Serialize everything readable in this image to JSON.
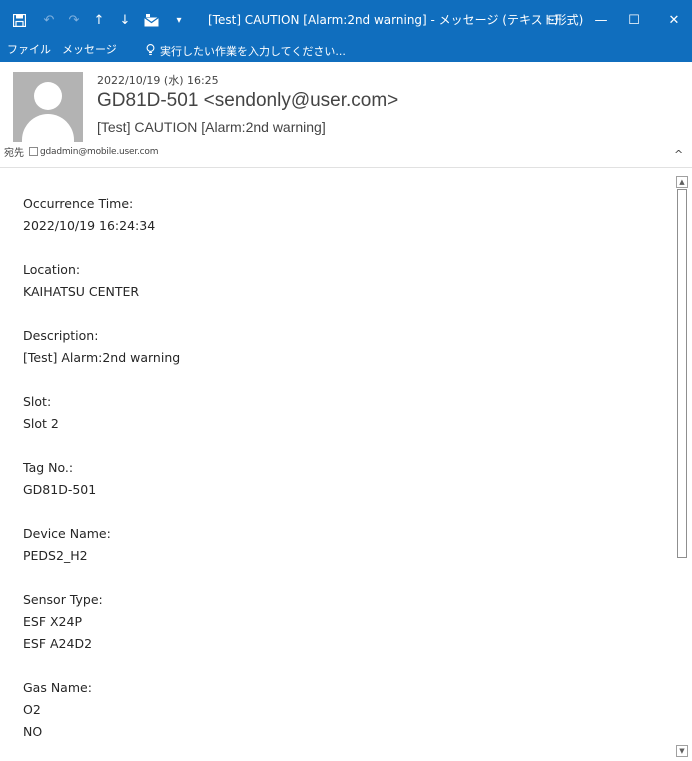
{
  "window": {
    "title": "[Test] CAUTION [Alarm:2nd warning] - メッセージ (テキスト形式)",
    "buttons": {
      "ribbon_display": "⊡",
      "minimize": "—",
      "maximize": "☐",
      "close": "✕"
    }
  },
  "qat": {
    "save_icon": "save-icon",
    "undo_icon": "undo-icon",
    "redo_icon": "redo-icon",
    "up_icon": "arrow-up-icon",
    "down_icon": "arrow-down-icon",
    "envelope_icon": "envelope-icon",
    "customize_icon": "customize-qat-icon"
  },
  "ribbon": {
    "tabs": [
      {
        "label": "ファイル"
      },
      {
        "label": "メッセージ"
      }
    ],
    "tell_me": "実行したい作業を入力してください..."
  },
  "header": {
    "date": "2022/10/19 (水) 16:25",
    "sender": "GD81D-501 <sendonly@user.com>",
    "subject": "[Test] CAUTION [Alarm:2nd warning]",
    "to_label": "宛先",
    "to_address": "gdadmin@mobile.user.com",
    "collapse_symbol": "^"
  },
  "body": {
    "occurrence_label": "Occurrence Time:",
    "occurrence_value": "2022/10/19 16:24:34",
    "location_label": "Location:",
    "location_value": "KAIHATSU CENTER",
    "description_label": "Description:",
    "description_value": "[Test] Alarm:2nd warning",
    "slot_label": "Slot:",
    "slot_value": "Slot 2",
    "tag_label": "Tag No.:",
    "tag_value": "GD81D-501",
    "device_label": "Device Name:",
    "device_value": "PEDS2_H2",
    "sensor_label": "Sensor Type:",
    "sensor_values": [
      "ESF X24P",
      "ESF A24D2"
    ],
    "gas_label": "Gas Name:",
    "gas_values": [
      "O2",
      "NO"
    ]
  },
  "colors": {
    "titlebar": "#106ebe",
    "text": "#262626"
  }
}
